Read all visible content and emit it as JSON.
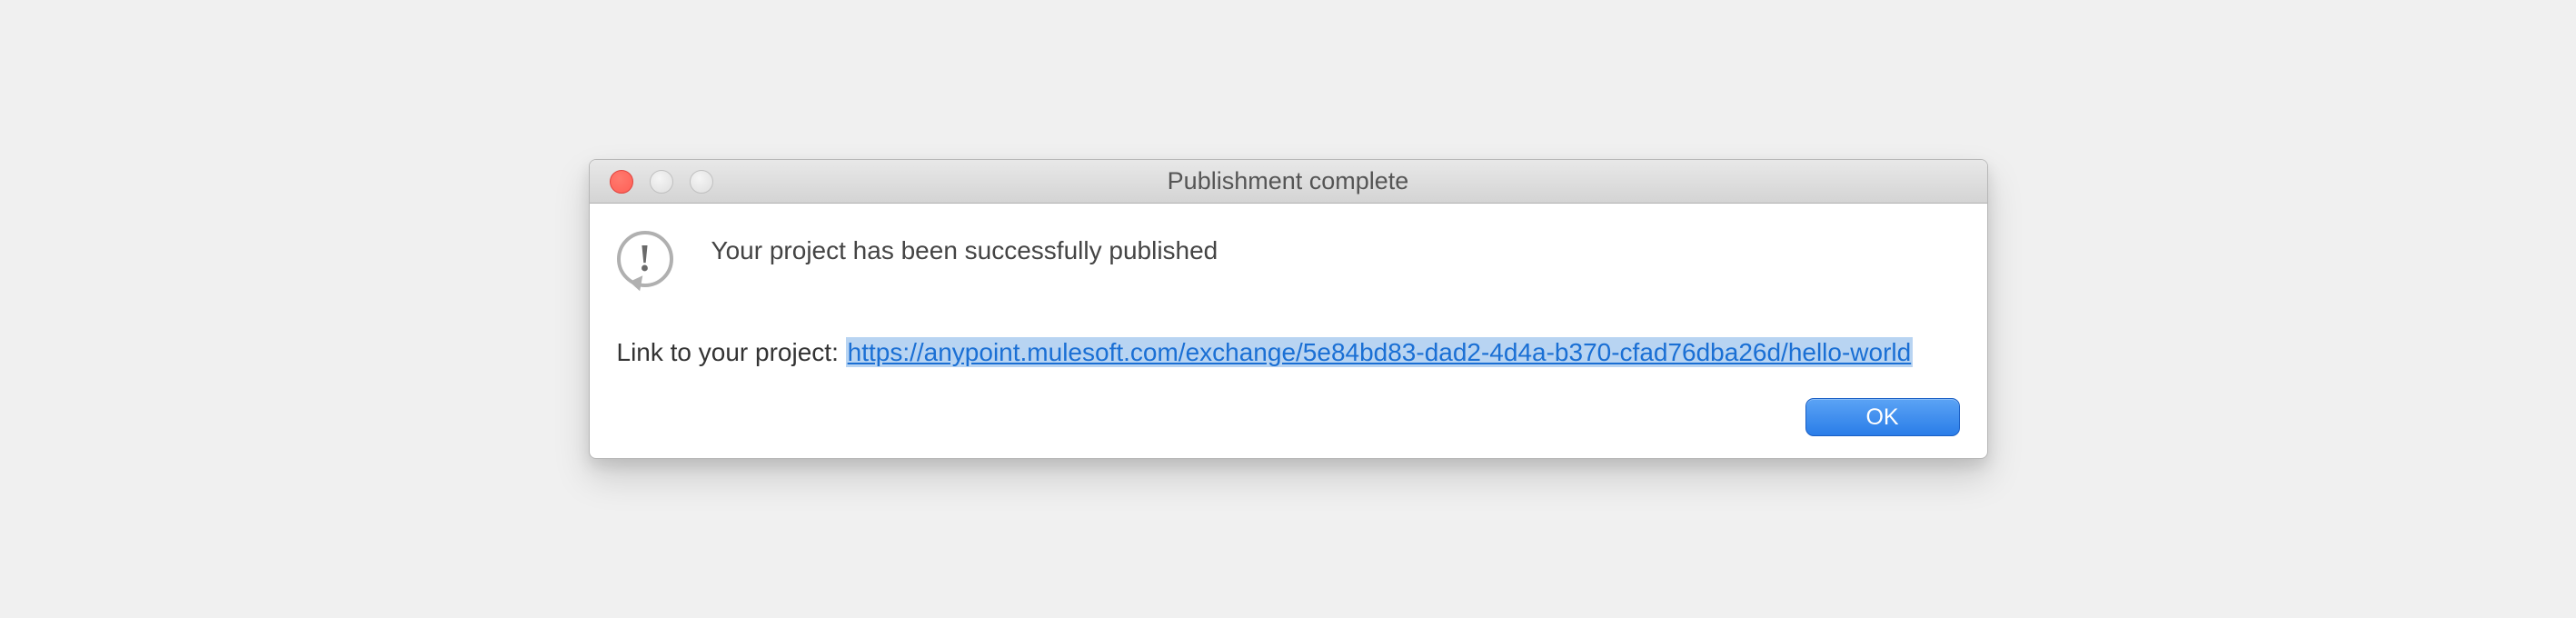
{
  "window": {
    "title": "Publishment complete"
  },
  "dialog": {
    "message": "Your project has been successfully published",
    "link_label": "Link to your project: ",
    "link_url": "https://anypoint.mulesoft.com/exchange/5e84bd83-dad2-4d4a-b370-cfad76dba26d/hello-world",
    "ok_label": "OK"
  },
  "icons": {
    "info": "exclamation-bubble"
  }
}
